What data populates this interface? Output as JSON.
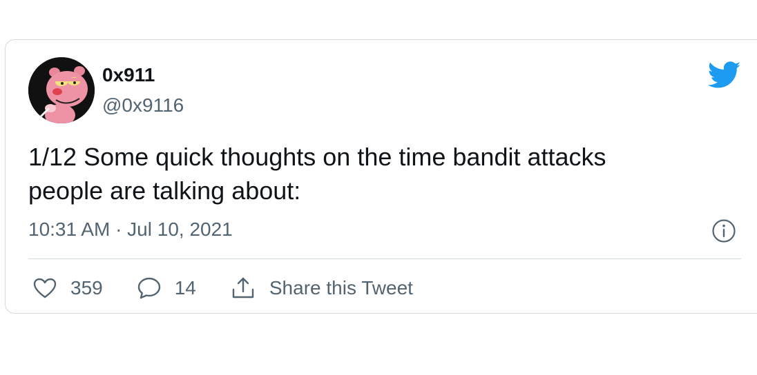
{
  "tweet": {
    "author": {
      "display_name": "0x911",
      "handle": "@0x9116",
      "avatar_icon": "pink-panther-avatar"
    },
    "text": "1/12 Some quick thoughts on the time bandit attacks\npeople are talking about:",
    "timestamp": "10:31 AM · Jul 10, 2021",
    "actions": {
      "likes": "359",
      "replies": "14",
      "share_label": "Share this Tweet"
    }
  },
  "icons": {
    "brand": "twitter-bird-icon",
    "info": "info-icon",
    "like": "heart-icon",
    "reply": "speech-bubble-icon",
    "share": "share-upload-icon"
  },
  "colors": {
    "twitter_blue": "#1d9bf0",
    "text_primary": "#0f1419",
    "text_secondary": "#536471",
    "border": "#cfd9de"
  }
}
